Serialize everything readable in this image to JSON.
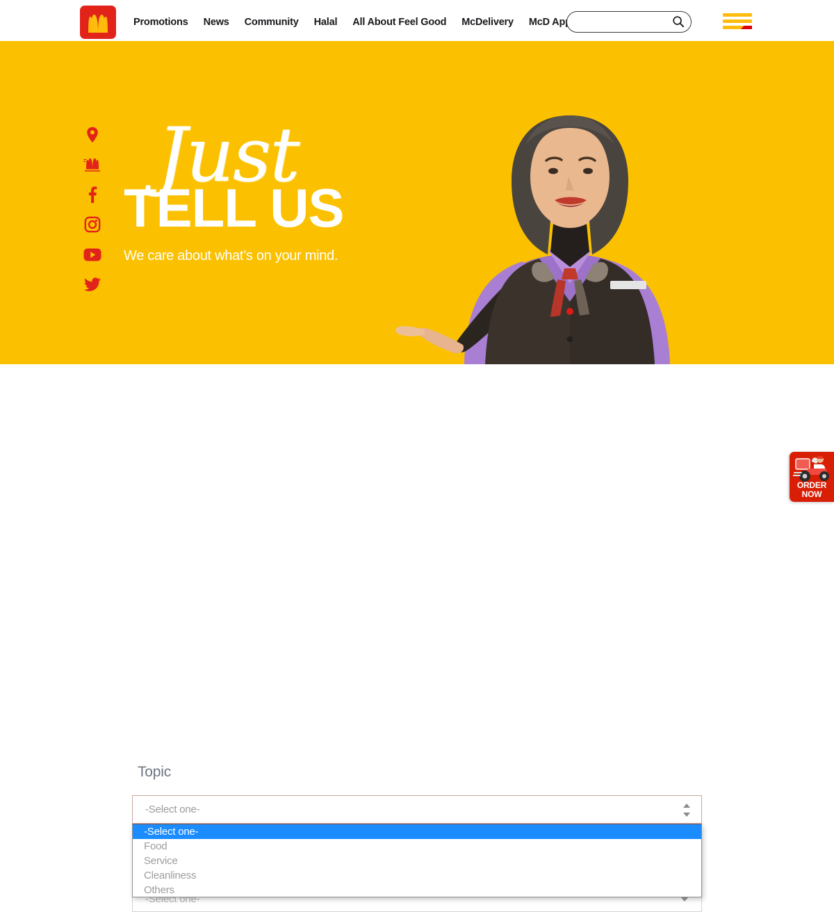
{
  "brand": {
    "logo_icon": "mcdonalds-arches-icon",
    "red": "#e2231a",
    "yellow": "#fbc100"
  },
  "header": {
    "nav": [
      {
        "label": "Promotions"
      },
      {
        "label": "News"
      },
      {
        "label": "Community"
      },
      {
        "label": "Halal"
      },
      {
        "label": "All About Feel Good"
      },
      {
        "label": "McDelivery"
      },
      {
        "label": "McD App"
      }
    ],
    "search": {
      "value": "",
      "placeholder": "",
      "icon": "search-icon"
    },
    "menu_icon": "hamburger-menu-icon"
  },
  "hero": {
    "script_title": "Just",
    "big_title": "TELL US",
    "tagline": "We care about what’s on your mind.",
    "background_color": "#fbc100",
    "social": [
      {
        "icon": "location-pin-icon",
        "name": "location"
      },
      {
        "icon": "mcdonalds-arches-icon",
        "name": "mcdonalds"
      },
      {
        "icon": "facebook-icon",
        "name": "facebook"
      },
      {
        "icon": "instagram-icon",
        "name": "instagram"
      },
      {
        "icon": "youtube-icon",
        "name": "youtube"
      },
      {
        "icon": "twitter-icon",
        "name": "twitter"
      }
    ],
    "image_alt": "McDonald’s crew member in uniform gesturing"
  },
  "form": {
    "topic_label": "Topic",
    "topic_select": {
      "value": "-Select one-",
      "open": true,
      "options": [
        {
          "label": "-Select one-",
          "selected": true
        },
        {
          "label": "Food",
          "selected": false
        },
        {
          "label": "Service",
          "selected": false
        },
        {
          "label": "Cleanliness",
          "selected": false
        },
        {
          "label": "Others",
          "selected": false
        }
      ]
    },
    "second_select": {
      "value": "-Select one-"
    },
    "highlight_color": "#1a8cff"
  },
  "order_badge": {
    "line1": "ORDER",
    "line2": "NOW",
    "icon": "delivery-scooter-icon",
    "color": "#d81e05"
  }
}
